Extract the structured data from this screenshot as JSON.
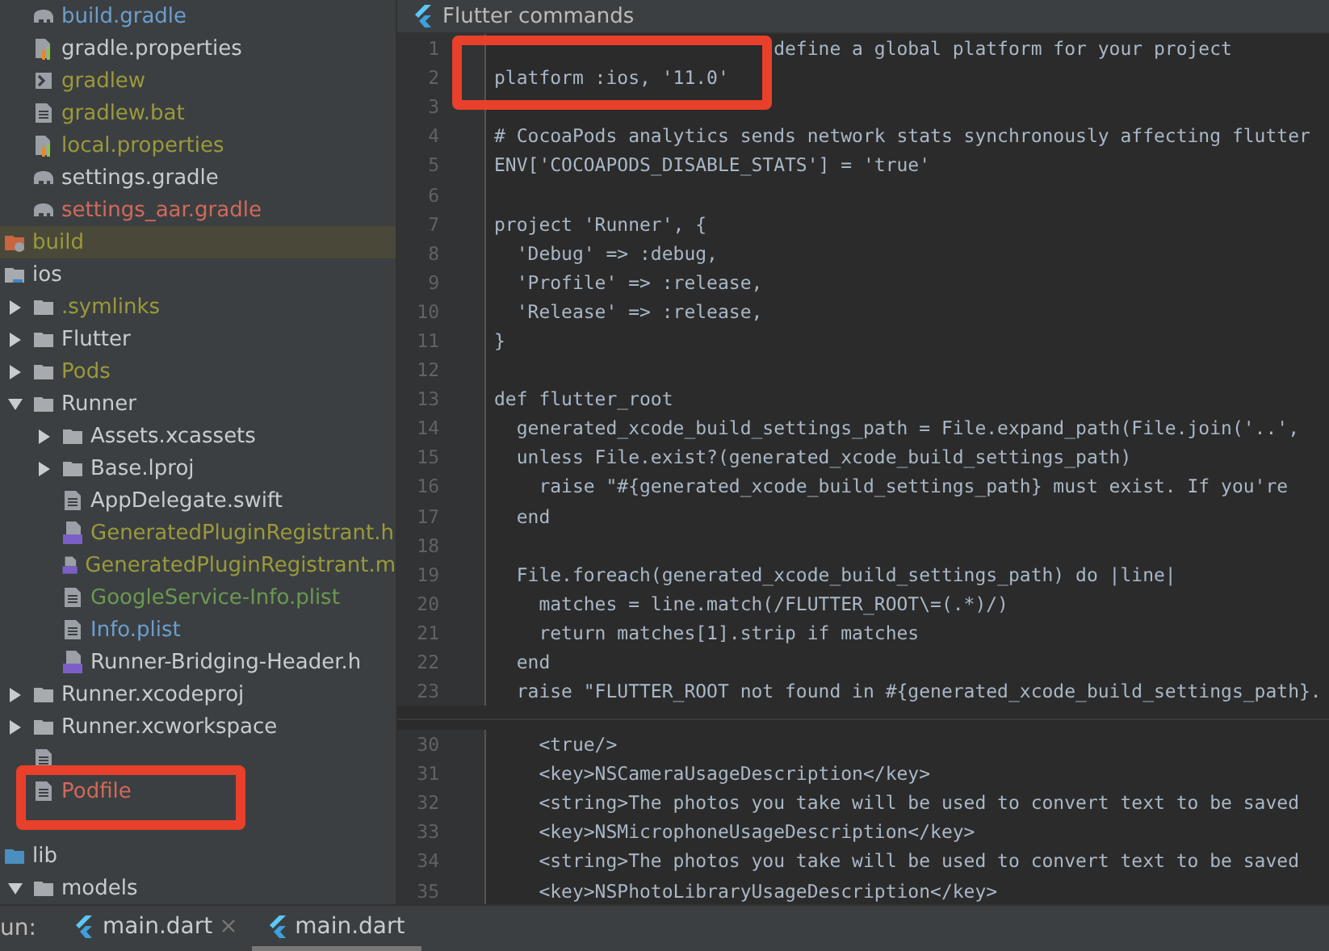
{
  "project_tree": [
    {
      "children": [
        {
          "label": "build.gradle",
          "kind": "gradle",
          "color": "#6a9fd0"
        },
        {
          "label": "gradle.properties",
          "kind": "properties",
          "color": "#c8cbcf"
        },
        {
          "label": "gradlew",
          "kind": "shell",
          "color": "#9a9a3a"
        },
        {
          "label": "gradlew.bat",
          "kind": "text",
          "color": "#9a9a3a"
        },
        {
          "label": "local.properties",
          "kind": "properties",
          "color": "#9a9a3a"
        },
        {
          "label": "settings.gradle",
          "kind": "gradle",
          "color": "#c8cbcf"
        },
        {
          "label": "settings_aar.gradle",
          "kind": "gradle",
          "color": "#d2695a"
        }
      ]
    },
    {
      "label": "build",
      "kind": "folder-excluded",
      "color": "#9a9a3a",
      "selected": true
    },
    {
      "label": "ios",
      "kind": "folder-module",
      "color": "#c8cbcf",
      "selected": false,
      "children": [
        {
          "label": ".symlinks",
          "kind": "folder",
          "color": "#9a9a3a",
          "expanded": false
        },
        {
          "label": "Flutter",
          "kind": "folder",
          "color": "#c8cbcf",
          "expanded": false
        },
        {
          "label": "Pods",
          "kind": "folder",
          "color": "#9a9a3a",
          "expanded": false
        },
        {
          "label": "Runner",
          "kind": "folder",
          "color": "#c8cbcf",
          "expanded": true,
          "children": [
            {
              "label": "Assets.xcassets",
              "kind": "folder",
              "color": "#c8cbcf",
              "expanded": false
            },
            {
              "label": "Base.lproj",
              "kind": "folder",
              "color": "#c8cbcf",
              "expanded": false
            },
            {
              "label": "AppDelegate.swift",
              "kind": "text",
              "color": "#c8cbcf"
            },
            {
              "label": "GeneratedPluginRegistrant.h",
              "kind": "cpp",
              "color": "#9a9a3a"
            },
            {
              "label": "GeneratedPluginRegistrant.m",
              "kind": "cpp",
              "color": "#9a9a3a"
            },
            {
              "label": "GoogleService-Info.plist",
              "kind": "text",
              "color": "#6a9a50"
            },
            {
              "label": "Info.plist",
              "kind": "text",
              "color": "#6a9fd0"
            },
            {
              "label": "Runner-Bridging-Header.h",
              "kind": "cpp",
              "color": "#c8cbcf"
            }
          ]
        },
        {
          "label": "Runner.xcodeproj",
          "kind": "folder",
          "color": "#c8cbcf",
          "expanded": false
        },
        {
          "label": "Runner.xcworkspace",
          "kind": "folder",
          "color": "#c8cbcf",
          "expanded": false
        },
        {
          "kind": "text"
        },
        {
          "label": "Podfile",
          "kind": "text",
          "color": "#d2695a"
        },
        {
          "kind": "covered"
        }
      ]
    },
    {
      "label": "lib",
      "kind": "folder-source",
      "color": "#c8cbcf",
      "selected": false,
      "children": [
        {
          "label": "models",
          "kind": "folder",
          "color": "#c8cbcf",
          "expanded": true
        }
      ]
    }
  ],
  "editor": {
    "title": "Flutter commands",
    "lines": [
      {
        "number": "1",
        "text": "                         define a global platform for your project"
      },
      {
        "number": "2",
        "text": "platform :ios, '11.0'"
      },
      {
        "number": "3"
      },
      {
        "number": "4",
        "text": "# CocoaPods analytics sends network stats synchronously affecting flutter"
      },
      {
        "number": "5",
        "text": "ENV['COCOAPODS_DISABLE_STATS'] = 'true'"
      },
      {
        "number": "6"
      },
      {
        "number": "7",
        "text": "project 'Runner', {"
      },
      {
        "number": "8",
        "text": "  'Debug' => :debug,"
      },
      {
        "number": "9",
        "text": "  'Profile' => :release,"
      },
      {
        "number": "10",
        "text": "  'Release' => :release,"
      },
      {
        "number": "11",
        "text": "}"
      },
      {
        "number": "12"
      },
      {
        "number": "13",
        "text": "def flutter_root"
      },
      {
        "number": "14",
        "text": "  generated_xcode_build_settings_path = File.expand_path(File.join('..',"
      },
      {
        "number": "15",
        "text": "  unless File.exist?(generated_xcode_build_settings_path)"
      },
      {
        "number": "16",
        "text": "    raise \"#{generated_xcode_build_settings_path} must exist. If you're"
      },
      {
        "number": "17",
        "text": "  end"
      },
      {
        "number": "18"
      },
      {
        "number": "19",
        "text": "  File.foreach(generated_xcode_build_settings_path) do |line|"
      },
      {
        "number": "20",
        "text": "    matches = line.match(/FLUTTER_ROOT\\=(.*)/)"
      },
      {
        "number": "21",
        "text": "    return matches[1].strip if matches"
      },
      {
        "number": "22",
        "text": "  end"
      },
      {
        "number": "23",
        "text": "  raise \"FLUTTER_ROOT not found in #{generated_xcode_build_settings_path}."
      }
    ]
  },
  "preview": {
    "lines": [
      {
        "number": "30",
        "text": "    <true/>"
      },
      {
        "number": "31",
        "text": "    <key>NSCameraUsageDescription</key>"
      },
      {
        "number": "32",
        "text": "    <string>The photos you take will be used to convert text to be saved"
      },
      {
        "number": "33",
        "text": "    <key>NSMicrophoneUsageDescription</key>"
      },
      {
        "number": "34",
        "text": "    <string>The photos you take will be used to convert text to be saved"
      },
      {
        "number": "35",
        "text": "    <key>NSPhotoLibraryUsageDescription</key>"
      }
    ]
  },
  "run_bar": {
    "label": "un:",
    "tabs": [
      {
        "label": "main.dart",
        "selected": false,
        "closable": true
      },
      {
        "label": "main.dart",
        "selected": true,
        "closable": false
      }
    ]
  },
  "annotations": [
    {
      "kind": "highlight"
    },
    {
      "kind": "highlight"
    }
  ]
}
